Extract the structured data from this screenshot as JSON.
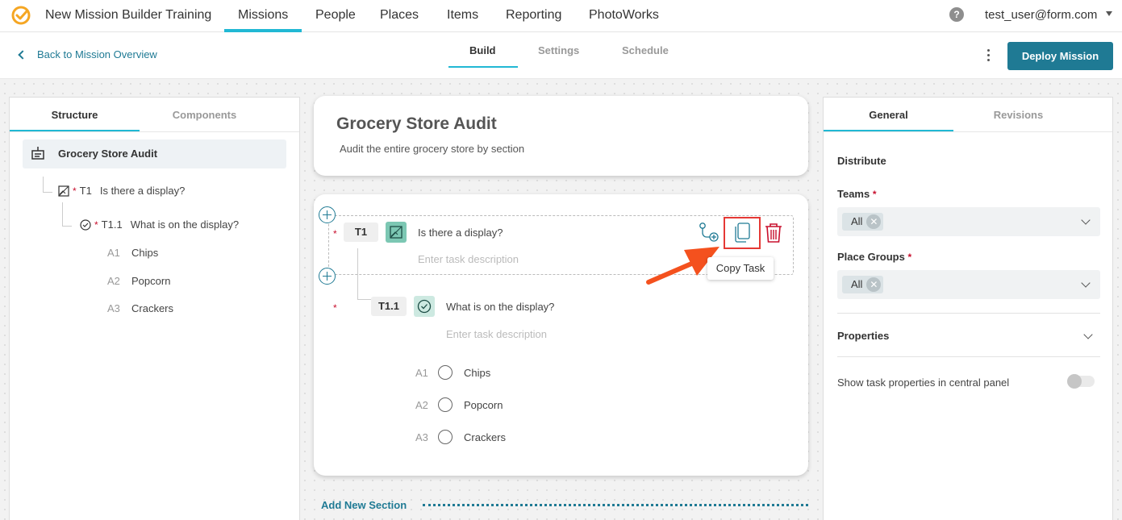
{
  "topnav": {
    "app_title": "New Mission Builder Training",
    "items": [
      "Missions",
      "People",
      "Places",
      "Items",
      "Reporting",
      "PhotoWorks"
    ],
    "active_item": "Missions",
    "help_label": "?",
    "user_email": "test_user@form.com"
  },
  "subheader": {
    "back_label": "Back to Mission Overview",
    "tabs": [
      "Build",
      "Settings",
      "Schedule"
    ],
    "active_tab": "Build",
    "deploy_label": "Deploy Mission"
  },
  "left_panel": {
    "tabs": [
      "Structure",
      "Components"
    ],
    "active_tab": "Structure",
    "root_label": "Grocery Store Audit",
    "tasks": [
      {
        "code": "T1",
        "label": "Is there a display?",
        "required": "*"
      },
      {
        "code": "T1.1",
        "label": "What is on the display?",
        "required": "*"
      }
    ],
    "options": [
      {
        "code": "A1",
        "label": "Chips"
      },
      {
        "code": "A2",
        "label": "Popcorn"
      },
      {
        "code": "A3",
        "label": "Crackers"
      }
    ]
  },
  "center": {
    "mission_title": "Grocery Store Audit",
    "mission_desc": "Audit the entire grocery store by section",
    "task1": {
      "code": "T1",
      "name": "Is there a display?",
      "desc_placeholder": "Enter task description",
      "required": "*"
    },
    "task2": {
      "code": "T1.1",
      "name": "What is on the display?",
      "desc_placeholder": "Enter task description",
      "required": "*"
    },
    "choices": [
      {
        "code": "A1",
        "label": "Chips"
      },
      {
        "code": "A2",
        "label": "Popcorn"
      },
      {
        "code": "A3",
        "label": "Crackers"
      }
    ],
    "tooltip": "Copy Task",
    "add_section_label": "Add New Section"
  },
  "right_panel": {
    "tabs": [
      "General",
      "Revisions"
    ],
    "active_tab": "General",
    "distribute_label": "Distribute",
    "teams_label": "Teams",
    "teams_required": "*",
    "teams_value": "All",
    "place_groups_label": "Place Groups",
    "place_groups_required": "*",
    "place_groups_value": "All",
    "properties_label": "Properties",
    "toggle_label": "Show task properties in central panel",
    "chip_remove": "✕"
  },
  "colors": {
    "accent": "#21b8d4",
    "primary": "#1f7a94",
    "required": "#c8102e",
    "highlight": "#e53935",
    "logo": "#f5a623"
  }
}
